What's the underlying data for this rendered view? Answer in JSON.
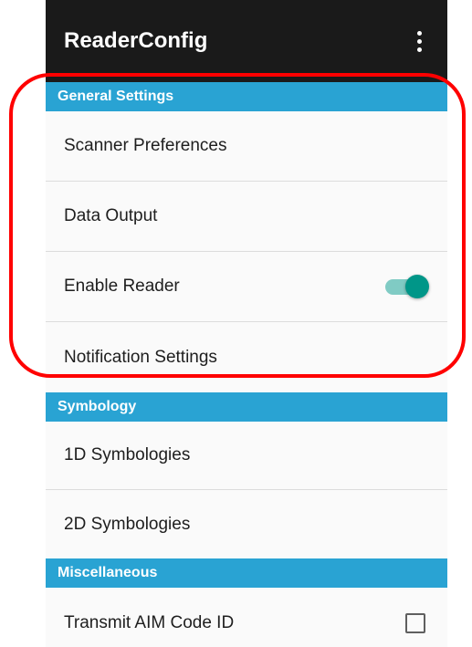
{
  "app_bar": {
    "title": "ReaderConfig",
    "menu_icon": "more-vert-icon"
  },
  "sections": {
    "general": {
      "header": "General Settings",
      "scanner_preferences": "Scanner Preferences",
      "data_output": "Data Output",
      "enable_reader": "Enable Reader",
      "enable_reader_checked": true,
      "notification_settings": "Notification Settings"
    },
    "symbology": {
      "header": "Symbology",
      "symbologies_1d": "1D Symbologies",
      "symbologies_2d": "2D Symbologies"
    },
    "misc": {
      "header": "Miscellaneous",
      "transmit_aim": "Transmit AIM Code ID",
      "transmit_aim_checked": false
    }
  },
  "colors": {
    "app_bar": "#1a1a1a",
    "section_header": "#29a3d3",
    "toggle_on": "#009688",
    "highlight": "#ff0000"
  }
}
